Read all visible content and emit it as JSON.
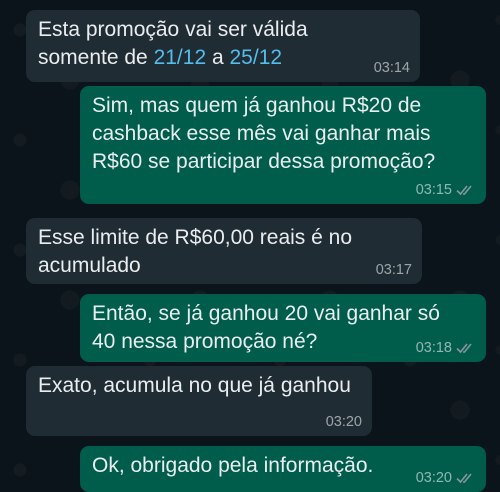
{
  "theme": {
    "incoming_bg": "#202c33",
    "outgoing_bg": "#005c4b",
    "read_ticks": "#8696a0",
    "link_color": "#53bdeb"
  },
  "messages": [
    {
      "direction": "incoming",
      "text_part1": "Esta promoção vai ser válida\nsomente de ",
      "link1": "21/12",
      "text_part2": " a ",
      "link2": "25/12",
      "time": "03:14"
    },
    {
      "direction": "outgoing",
      "text": "Sim, mas quem já ganhou R$20 de\ncashback esse mês vai ganhar mais\nR$60 se participar dessa promoção?",
      "time": "03:15",
      "status_icon": "double-check-icon"
    },
    {
      "direction": "incoming",
      "text": "Esse limite de R$60,00 reais é no\nacumulado",
      "time": "03:17"
    },
    {
      "direction": "outgoing",
      "text": "Então, se já ganhou 20 vai ganhar só\n40 nessa promoção né?",
      "time": "03:18",
      "status_icon": "double-check-icon"
    },
    {
      "direction": "incoming",
      "text": "Exato, acumula no que já ganhou",
      "time": "03:20"
    },
    {
      "direction": "outgoing",
      "text": "Ok, obrigado pela informação.",
      "time": "03:20",
      "status_icon": "double-check-icon"
    }
  ]
}
